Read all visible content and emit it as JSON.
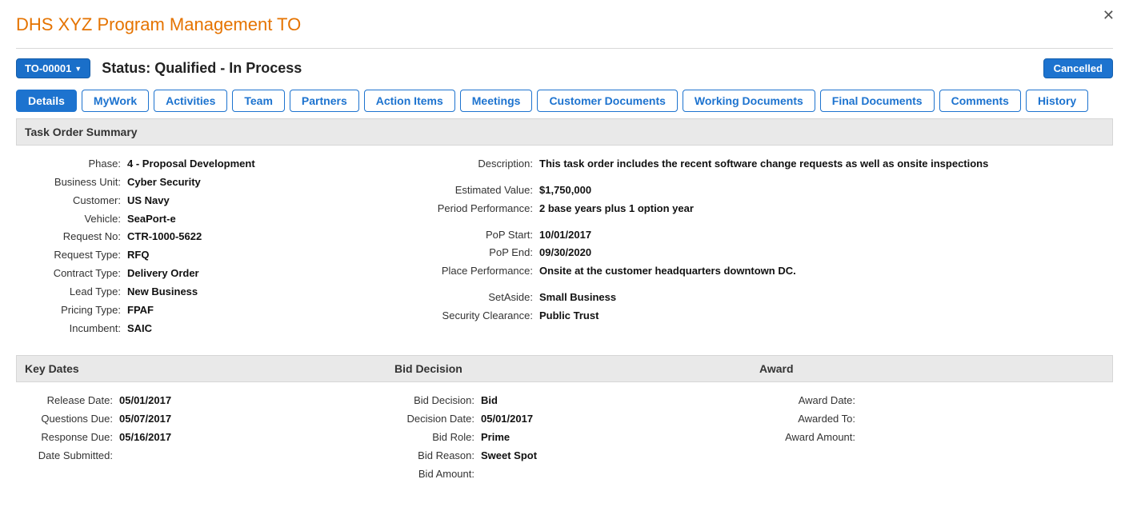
{
  "page_title": "DHS XYZ Program Management TO",
  "dropdown_label": "TO-00001",
  "status_line": "Status: Qualified - In Process",
  "cancelled_label": "Cancelled",
  "tabs": {
    "details": "Details",
    "mywork": "MyWork",
    "activities": "Activities",
    "team": "Team",
    "partners": "Partners",
    "action_items": "Action Items",
    "meetings": "Meetings",
    "customer_docs": "Customer Documents",
    "working_docs": "Working Documents",
    "final_docs": "Final Documents",
    "comments": "Comments",
    "history": "History"
  },
  "summary_header": "Task Order Summary",
  "summary_left": {
    "phase_l": "Phase:",
    "phase_v": "4 - Proposal Development",
    "bu_l": "Business Unit:",
    "bu_v": "Cyber Security",
    "customer_l": "Customer:",
    "customer_v": "US Navy",
    "vehicle_l": "Vehicle:",
    "vehicle_v": "SeaPort-e",
    "reqno_l": "Request No:",
    "reqno_v": "CTR-1000-5622",
    "reqtype_l": "Request Type:",
    "reqtype_v": "RFQ",
    "ctype_l": "Contract Type:",
    "ctype_v": "Delivery Order",
    "ltype_l": "Lead Type:",
    "ltype_v": "New Business",
    "ptype_l": "Pricing Type:",
    "ptype_v": "FPAF",
    "inc_l": "Incumbent:",
    "inc_v": "SAIC"
  },
  "summary_right": {
    "desc_l": "Description:",
    "desc_v": "This task order includes the recent software change requests as well as onsite inspections",
    "est_l": "Estimated Value:",
    "est_v": "$1,750,000",
    "pp_l": "Period Performance:",
    "pp_v": "2 base years plus 1 option year",
    "pstart_l": "PoP Start:",
    "pstart_v": "10/01/2017",
    "pend_l": "PoP End:",
    "pend_v": "09/30/2020",
    "place_l": "Place Performance:",
    "place_v": "Onsite at the customer headquarters downtown DC.",
    "sa_l": "SetAside:",
    "sa_v": "Small Business",
    "sc_l": "Security Clearance:",
    "sc_v": "Public Trust"
  },
  "headers2": {
    "key_dates": "Key Dates",
    "bid_decision": "Bid Decision",
    "award": "Award"
  },
  "key_dates": {
    "rel_l": "Release Date:",
    "rel_v": "05/01/2017",
    "q_l": "Questions Due:",
    "q_v": "05/07/2017",
    "resp_l": "Response Due:",
    "resp_v": "05/16/2017",
    "sub_l": "Date Submitted:",
    "sub_v": ""
  },
  "bid": {
    "bd_l": "Bid Decision:",
    "bd_v": "Bid",
    "dd_l": "Decision Date:",
    "dd_v": "05/01/2017",
    "br_l": "Bid Role:",
    "br_v": "Prime",
    "brs_l": "Bid Reason:",
    "brs_v": "Sweet Spot",
    "ba_l": "Bid Amount:",
    "ba_v": ""
  },
  "award": {
    "ad_l": "Award Date:",
    "ad_v": "",
    "at_l": "Awarded To:",
    "at_v": "",
    "aa_l": "Award Amount:",
    "aa_v": ""
  }
}
